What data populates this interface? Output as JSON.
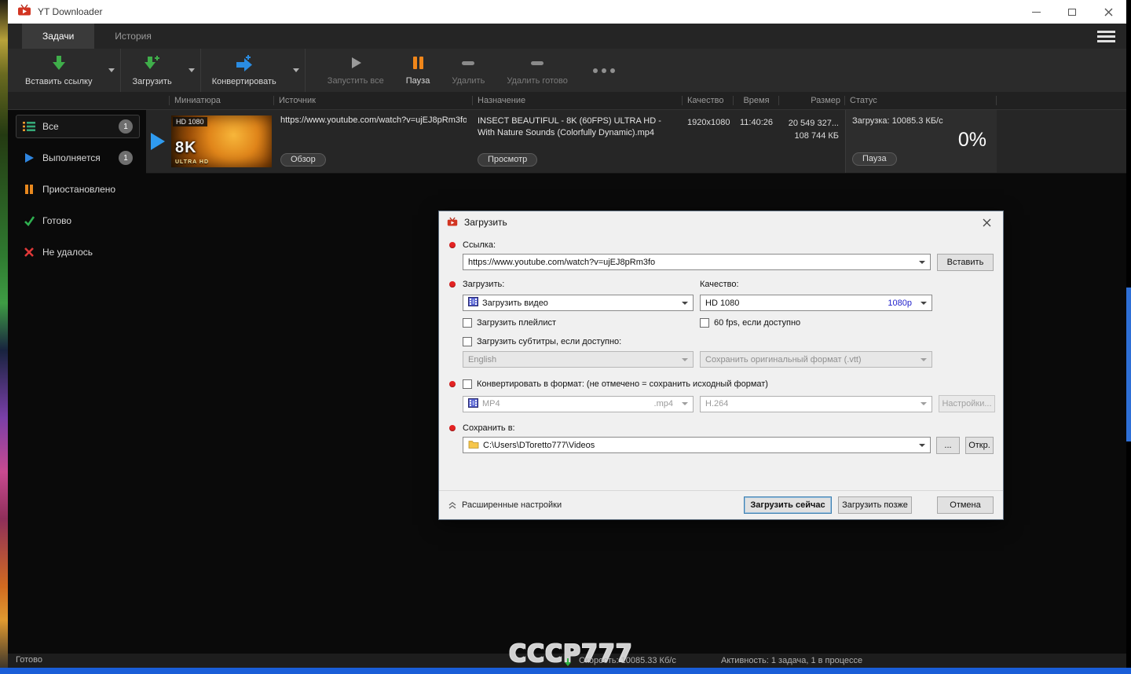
{
  "window": {
    "title": "YT Downloader"
  },
  "tabs": {
    "tasks": "Задачи",
    "history": "История"
  },
  "toolbar": {
    "paste_link": "Вставить ссылку",
    "download": "Загрузить",
    "convert": "Конвертировать",
    "start_all": "Запустить все",
    "pause": "Пауза",
    "delete": "Удалить",
    "delete_done": "Удалить готово"
  },
  "sidebar": {
    "all": "Все",
    "all_count": "1",
    "running": "Выполняется",
    "running_count": "1",
    "paused": "Приостановлено",
    "done": "Готово",
    "failed": "Не удалось"
  },
  "table": {
    "columns": {
      "thumbnail": "Миниатюра",
      "source": "Источник",
      "destination": "Назначение",
      "quality": "Качество",
      "time": "Время",
      "size": "Размер",
      "status": "Статус"
    },
    "row": {
      "thumb_hd": "HD 1080",
      "thumb_8k": "8K",
      "thumb_ultra": "ULTRA HD",
      "source_url": "https://www.youtube.com/watch?v=ujEJ8pRm3fo",
      "source_button": "Обзор",
      "destination": "INSECT BEAUTIFUL - 8K (60FPS) ULTRA HD - With Nature Sounds (Colorfully Dynamic).mp4",
      "destination_button": "Просмотр",
      "quality": "1920x1080",
      "time": "11:40:26",
      "size_line1": "20 549 327...",
      "size_line2": "108 744 КБ",
      "status_speed": "Загрузка: 10085.3 КБ/с",
      "status_percent": "0%",
      "status_button": "Пауза"
    }
  },
  "dialog": {
    "title": "Загрузить",
    "link_label": "Ссылка:",
    "link_value": "https://www.youtube.com/watch?v=ujEJ8pRm3fo",
    "paste_button": "Вставить",
    "download_label": "Загрузить:",
    "quality_label": "Качество:",
    "download_type": "Загрузить видео",
    "quality_value": "HD 1080",
    "quality_res": "1080p",
    "playlist_checkbox": "Загрузить плейлист",
    "fps_checkbox": "60 fps, если доступно",
    "subtitles_checkbox": "Загрузить субтитры, если доступно:",
    "subtitle_lang": "English",
    "subtitle_format": "Сохранить оригинальный формат (.vtt)",
    "convert_checkbox": "Конвертировать в формат: (не отмечено = сохранить исходный формат)",
    "format_value": "MP4",
    "format_ext": ".mp4",
    "codec_value": "H.264",
    "settings_button": "Настройки...",
    "save_label": "Сохранить в:",
    "save_path": "C:\\Users\\DToretto777\\Videos",
    "browse_button": "...",
    "open_button": "Откр.",
    "advanced_label": "Расширенные настройки",
    "download_now": "Загрузить сейчас",
    "download_later": "Загрузить позже",
    "cancel": "Отмена"
  },
  "statusbar": {
    "left": "Готово",
    "watermark": "СССР777",
    "speed": "Скорость: 10085.33 Кб/с",
    "activity": "Активность: 1 задача, 1 в процессе"
  },
  "colors": {
    "accent_green": "#3fae4a",
    "accent_blue": "#2a8ce2",
    "accent_orange": "#f0861a",
    "accent_red": "#e03232"
  },
  "icons": {
    "app": "tv-play",
    "paste_link": "arrow-down-green",
    "download": "arrow-down-plus-green",
    "convert": "arrow-right-plus-blue",
    "start_all": "play-gray",
    "pause": "pause-orange",
    "delete": "bar-gray",
    "more": "ellipsis",
    "menu": "hamburger",
    "all": "list",
    "running": "play-blue",
    "done": "check-green",
    "failed": "cross-red",
    "video": "filmstrip",
    "folder": "folder-yellow"
  }
}
